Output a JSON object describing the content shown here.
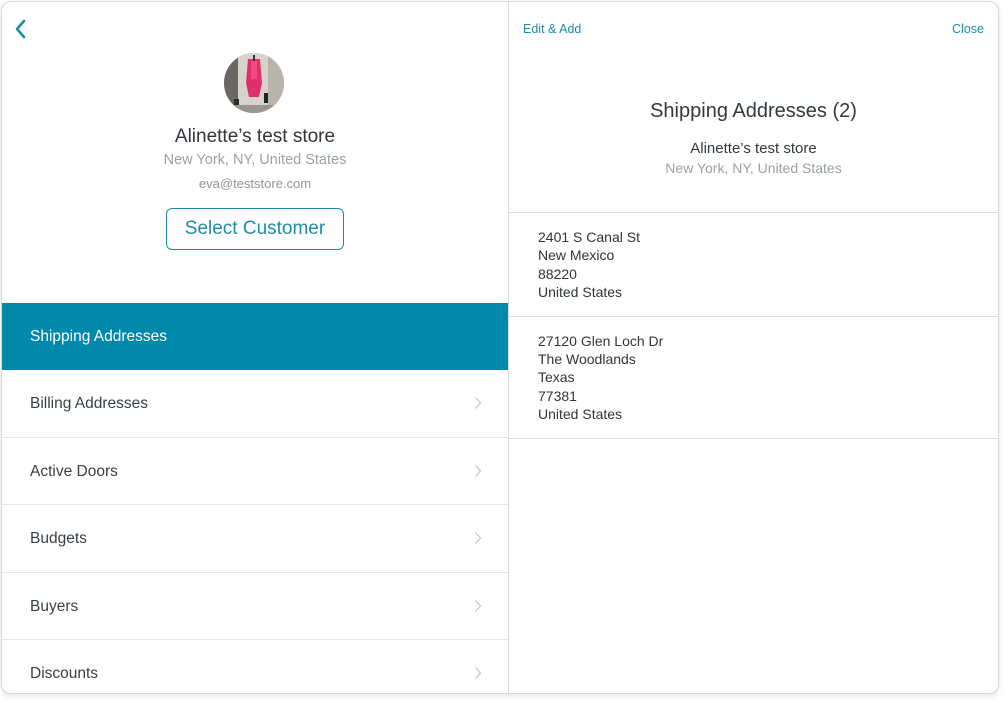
{
  "left": {
    "back_icon": "chevron-left-icon",
    "store_name": "Alinette’s test store",
    "store_location": "New York, NY, United States",
    "store_email": "eva@teststore.com",
    "select_customer_label": "Select Customer",
    "menu": [
      {
        "label": "Shipping Addresses",
        "active": true
      },
      {
        "label": "Billing Addresses",
        "active": false
      },
      {
        "label": "Active Doors",
        "active": false
      },
      {
        "label": "Budgets",
        "active": false
      },
      {
        "label": "Buyers",
        "active": false
      },
      {
        "label": "Discounts",
        "active": false
      }
    ]
  },
  "right": {
    "edit_add_label": "Edit & Add",
    "close_label": "Close",
    "title": "Shipping Addresses (2)",
    "store_name": "Alinette’s test store",
    "store_location": "New York, NY, United States",
    "addresses": [
      {
        "lines": [
          "2401 S Canal St",
          "New Mexico",
          "88220",
          "United States"
        ]
      },
      {
        "lines": [
          "27120 Glen Loch Dr",
          "The Woodlands",
          "Texas",
          "77381",
          "United States"
        ]
      }
    ]
  },
  "colors": {
    "accent": "#0089ab",
    "link": "#1f8ba6",
    "muted_text": "#9aa1a7"
  }
}
